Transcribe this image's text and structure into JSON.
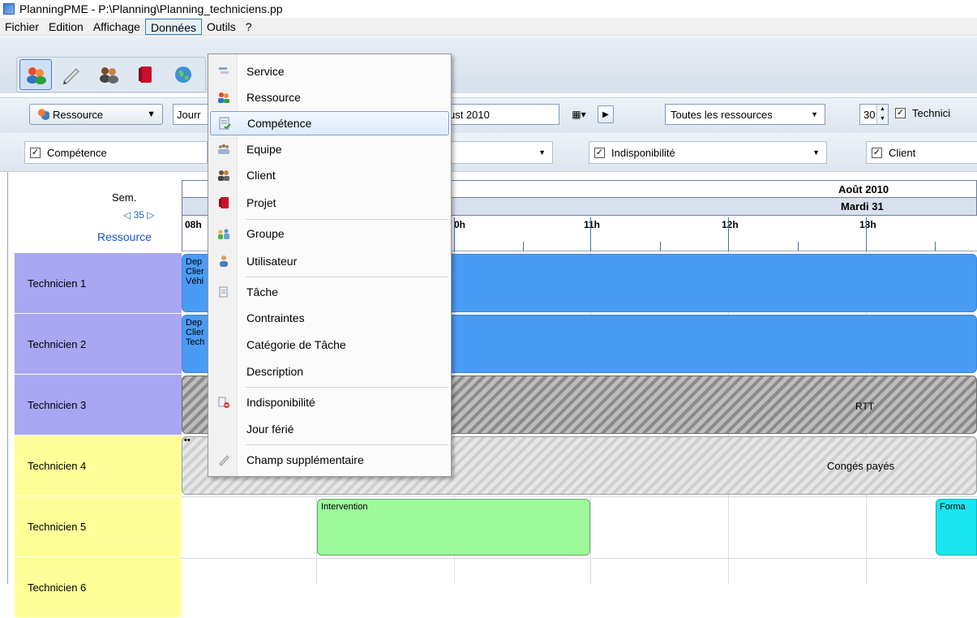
{
  "window": {
    "title": "PlanningPME - P:\\Planning\\Planning_techniciens.pp"
  },
  "menubar": {
    "items": [
      "Fichier",
      "Edition",
      "Affichage",
      "Données",
      "Outils",
      "?"
    ],
    "open_item": "Données"
  },
  "donnees_menu": {
    "items": [
      {
        "label": "Service",
        "icon": "service-icon"
      },
      {
        "label": "Ressource",
        "icon": "resource-icon"
      },
      {
        "label": "Compétence",
        "icon": "competence-icon",
        "highlighted": true
      },
      {
        "label": "Equipe",
        "icon": "team-icon"
      },
      {
        "label": "Client",
        "icon": "client-icon"
      },
      {
        "label": "Projet",
        "icon": "project-icon"
      },
      {
        "label": "Groupe",
        "icon": "group-icon"
      },
      {
        "label": "Utilisateur",
        "icon": "user-icon"
      },
      {
        "label": "Tâche",
        "icon": "task-icon"
      },
      {
        "label": "Contraintes",
        "icon": ""
      },
      {
        "label": "Catégorie de Tâche",
        "icon": ""
      },
      {
        "label": "Description",
        "icon": ""
      },
      {
        "label": "Indisponibilité",
        "icon": "unavailability-icon"
      },
      {
        "label": "Jour férié",
        "icon": ""
      },
      {
        "label": "Champ supplémentaire",
        "icon": "extra-field-icon"
      }
    ]
  },
  "toolbar": {
    "resource_button": "Ressource",
    "view_combo_partial": "Jourr",
    "date_combo_partial": "ust  2010",
    "resources_filter": "Toutes les ressources",
    "count_value": "30",
    "technicians_checkbox_partial": "Technici"
  },
  "filters": {
    "competence": "Compétence",
    "indisponibilite": "Indisponibilité",
    "client": "Client"
  },
  "grid": {
    "sem_label": "Sem.",
    "week_label": "35",
    "resource_link": "Ressource",
    "month_label": "Août 2010",
    "day_label": "Mardi 31",
    "hours": [
      "08h",
      "0h",
      "11h",
      "12h",
      "13h"
    ],
    "rows": [
      "Technicien 1",
      "Technicien 2",
      "Technicien 3",
      "Technicien 4",
      "Technicien 5",
      "Technicien 6"
    ],
    "row_colors": [
      "#a9a6f3",
      "#a9a6f3",
      "#a9a6f3",
      "#ffff99",
      "#ffff99",
      "#ffff99"
    ]
  },
  "events": {
    "t1_lines": [
      "Dep",
      "Clier",
      "Véhi"
    ],
    "t2_lines": [
      "Dep",
      "Clier",
      "Tech"
    ],
    "t3_label": "RTT",
    "t4_label": "Congés payés",
    "t4_dots": "••",
    "t5_label": "Intervention",
    "t5_partial": "Forma"
  }
}
